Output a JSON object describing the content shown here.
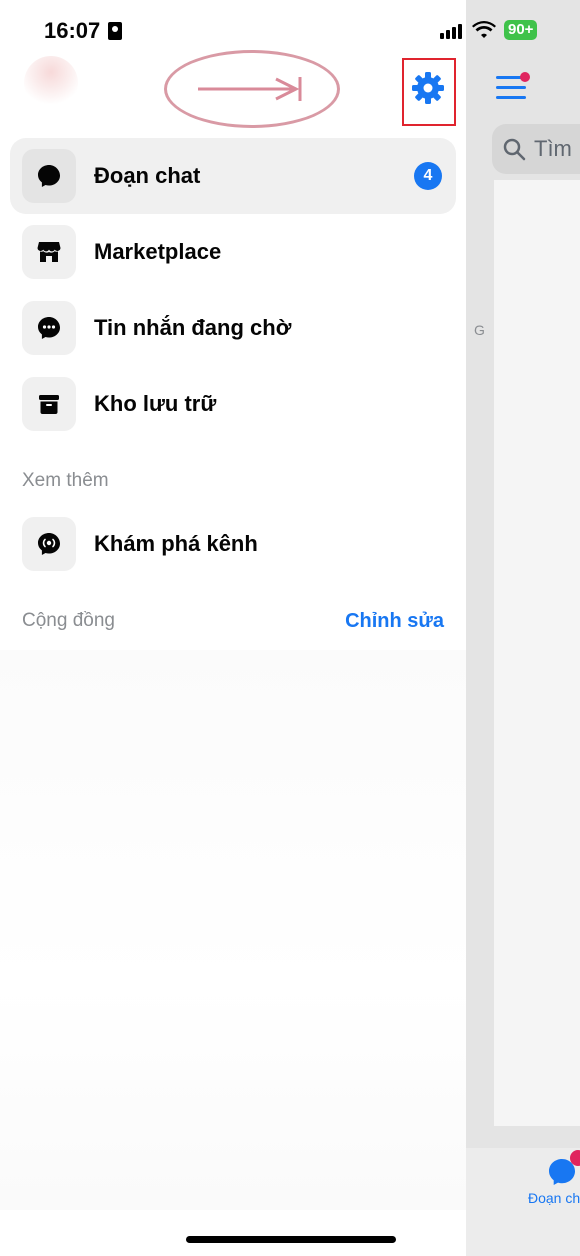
{
  "status_bar": {
    "time": "16:07",
    "battery": "90+"
  },
  "menu": {
    "items": [
      {
        "label": "Đoạn chat",
        "icon": "chat-bubble-icon",
        "badge": "4",
        "active": true
      },
      {
        "label": "Marketplace",
        "icon": "store-icon",
        "active": false
      },
      {
        "label": "Tin nhắn đang chờ",
        "icon": "message-pending-icon",
        "active": false
      },
      {
        "label": "Kho lưu trữ",
        "icon": "archive-icon",
        "active": false
      }
    ]
  },
  "see_more": {
    "title": "Xem thêm",
    "items": [
      {
        "label": "Khám phá kênh",
        "icon": "broadcast-channel-icon"
      }
    ]
  },
  "community": {
    "title": "Cộng đồng",
    "edit_label": "Chỉnh sửa"
  },
  "background_app": {
    "search_placeholder": "Tìm",
    "letter": "G",
    "bottom_tab_label": "Đoạn ch"
  },
  "colors": {
    "accent": "#1877f2",
    "annotation_box": "#e0242e",
    "annotation_oval": "#d99aa5"
  }
}
